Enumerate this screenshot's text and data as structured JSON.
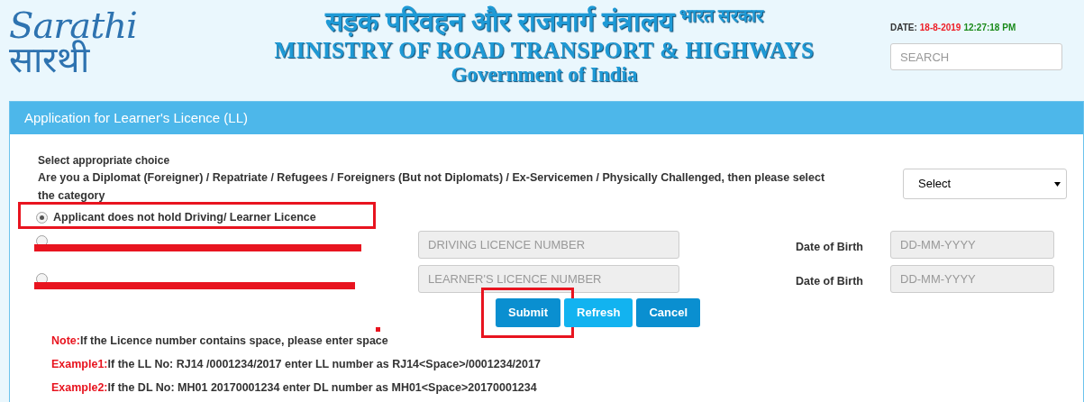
{
  "logo": {
    "latin": "Sarathi",
    "hindi": "सारथी"
  },
  "header": {
    "hindi_title": "सड़क परिवहन और राजमार्ग मंत्रालय",
    "hindi_sub": "भारत सरकार",
    "title": "MINISTRY OF ROAD TRANSPORT & HIGHWAYS",
    "subtitle": "Government of India"
  },
  "date": {
    "label": "DATE:",
    "date": "18-8-2019",
    "time": "12:27:18 PM"
  },
  "search": {
    "placeholder": "SEARCH"
  },
  "panel": {
    "title": "Application for Learner's Licence (LL)"
  },
  "form": {
    "heading": "Select appropriate choice",
    "question": "Are you a Diplomat (Foreigner) / Repatriate / Refugees / Foreigners (But not Diplomats) / Ex-Servicemen / Physically Challenged, then please select the category",
    "category_select": "Select",
    "options": [
      {
        "kind": "plain",
        "label": "Applicant does not hold Driving/ Learner Licence",
        "selected": true,
        "highlighted": true
      },
      {
        "kind": "licence",
        "selected": false,
        "placeholder": "DRIVING LICENCE NUMBER",
        "dob_label": "Date of Birth",
        "dob_placeholder": "DD-MM-YYYY",
        "redacted": true
      },
      {
        "kind": "licence",
        "selected": false,
        "placeholder": "LEARNER'S LICENCE NUMBER",
        "dob_label": "Date of Birth",
        "dob_placeholder": "DD-MM-YYYY",
        "redacted": true
      }
    ]
  },
  "buttons": [
    {
      "label": "Submit",
      "highlighted": true
    },
    {
      "label": "Refresh",
      "highlighted": false
    },
    {
      "label": "Cancel",
      "highlighted": false
    }
  ],
  "notes": [
    {
      "tag": "Note:",
      "text": "If the Licence number contains space, please enter space"
    },
    {
      "tag": "Example1:",
      "text": "If the LL No: RJ14 /0001234/2017 enter LL number as RJ14<Space>/0001234/2017"
    },
    {
      "tag": "Example2:",
      "text": "If the DL No: MH01 20170001234 enter DL number as MH01<Space>20170001234"
    }
  ]
}
